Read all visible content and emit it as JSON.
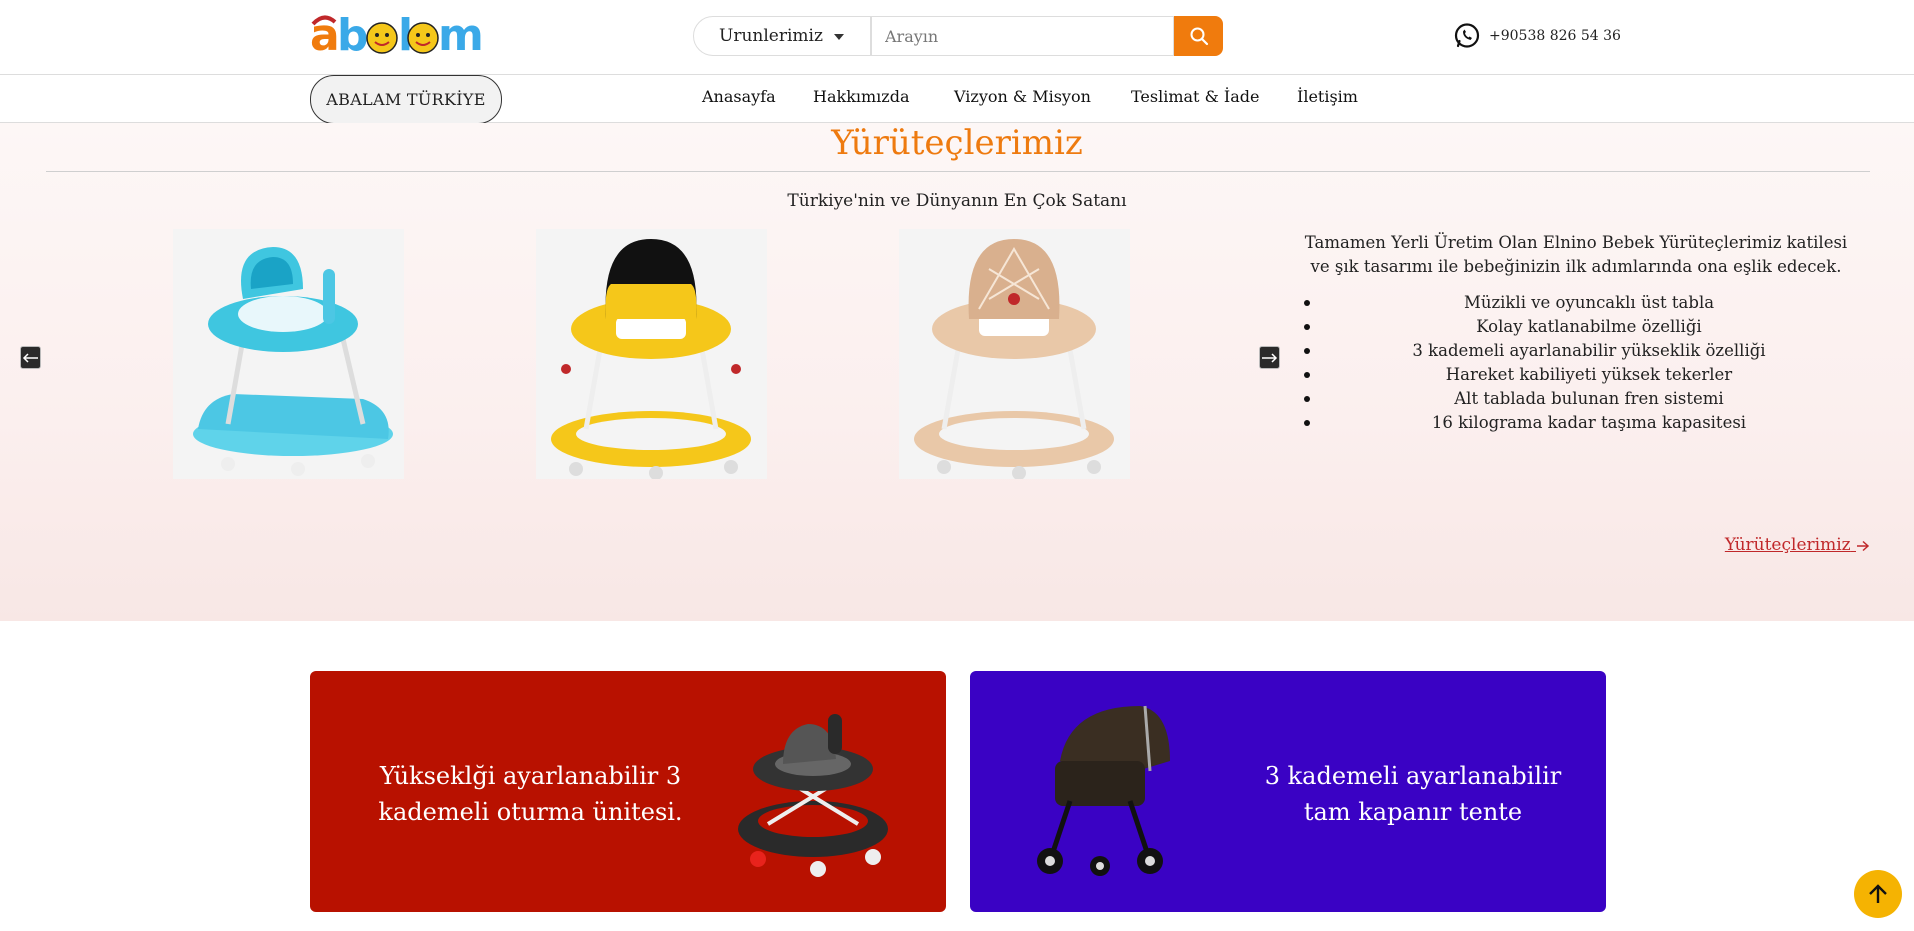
{
  "header": {
    "logo_text": "abalam",
    "dropdown_label": "Urunlerimiz",
    "search_placeholder": "Arayın",
    "phone": "+90538 826 54 36"
  },
  "nav": {
    "brand": "ABALAM TÜRKİYE",
    "items": [
      "Anasayfa",
      "Hakkımızda",
      "Vizyon & Misyon",
      "Teslimat & İade",
      "İletişim"
    ]
  },
  "hero": {
    "title": "Yürüteçlerimiz",
    "subtitle": "Türkiye'nin ve Dünyanın En Çok Satanı",
    "description": "Tamamen Yerli Üretim Olan Elnino Bebek Yürüteçlerimiz katilesi ve şık tasarımı ile bebeğinizin ilk adımlarında ona eşlik edecek.",
    "features": [
      "Müzikli ve oyuncaklı üst tabla",
      "Kolay katlanabilme özelliği",
      "3 kademeli ayarlanabilir yükseklik özelliği",
      "Hareket kabiliyeti yüksek tekerler",
      "Alt tablada bulunan fren sistemi",
      "16 kilograma kadar taşıma kapasitesi"
    ],
    "link_label": "Yürüteçlerimiz",
    "products": [
      {
        "color": "#3fc6e0"
      },
      {
        "color": "#f5c71a"
      },
      {
        "color": "#e9c8a8"
      }
    ]
  },
  "promos": {
    "red_text": "Yükseklği ayarlanabilir 3 kademeli oturma ünitesi.",
    "blue_text": "3 kademeli ayarlanabilir tam kapanır tente"
  },
  "colors": {
    "accent_orange": "#f07b0d",
    "promo_red": "#b81100",
    "promo_blue": "#3a02c4",
    "scroll_button": "#f5b302",
    "link_red": "#c0282a"
  }
}
